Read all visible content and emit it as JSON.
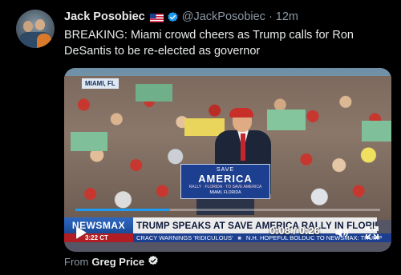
{
  "tweet": {
    "author_name": "Jack Posobiec",
    "handle": "@JackPosobiec",
    "separator": "·",
    "time": "12m",
    "text": "BREAKING: Miami crowd cheers as Trump calls for Ron DeSantis to be re-elected as governor",
    "avatar_icon": "user-avatar",
    "flag_icon": "us-flag-icon",
    "verified_icon": "verified-badge-icon"
  },
  "video": {
    "sign_location": "MIAMI, FL",
    "podium": {
      "line1": "SAVE",
      "line2": "AMERICA",
      "line3": "RALLY · FLORIDA · TO SAVE AMERICA",
      "line4": "MIAMI, FLORIDA"
    },
    "network_logo": "NEWSMAX",
    "headline": "TRUMP SPEAKS AT SAVE AMERICA RALLY IN FLORIDA",
    "ticker_time": "3:22 CT",
    "ticker_items": [
      "CRACY WARNINGS 'RIDICULOUS'",
      "N.H. HOPEFUL BOLDUC TO NEWSMAX: TRUMP"
    ],
    "timecode": "0:08 / 0:26",
    "progress_fraction": 0.31,
    "accent_color": "#1d9bf0",
    "controls": [
      "play-icon",
      "volume-icon",
      "fullscreen-icon"
    ]
  },
  "attribution": {
    "from_label": "From",
    "source_name": "Greg Price"
  }
}
